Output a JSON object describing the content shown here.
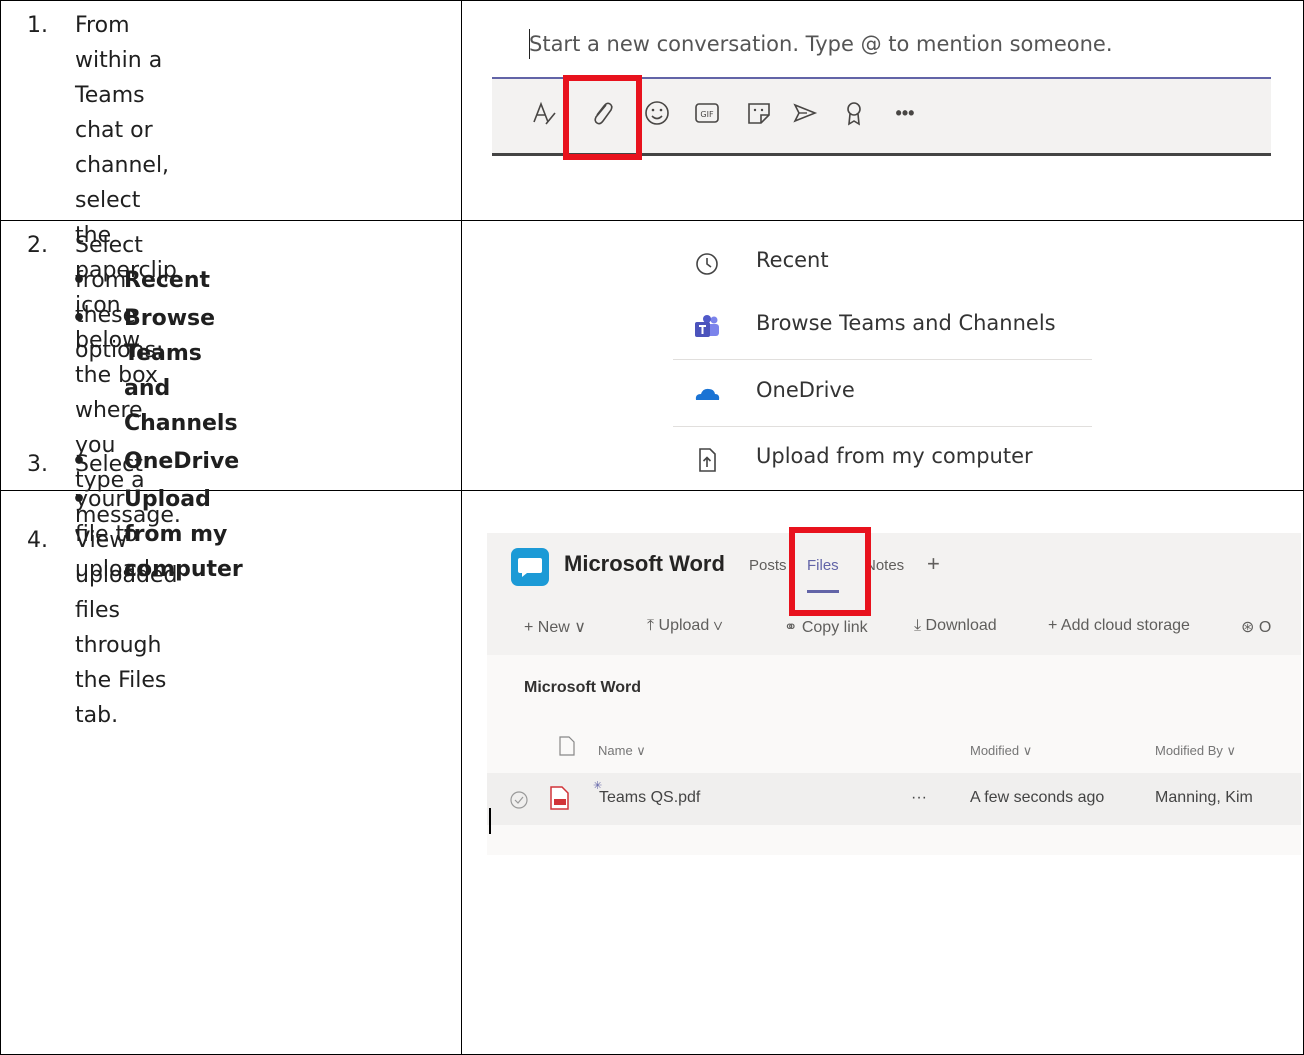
{
  "steps": [
    {
      "num": "1.",
      "lines": [
        "From within a Teams chat or",
        "channel, select the paperclip",
        "icon below the box where you",
        "type a message."
      ]
    },
    {
      "num": "2.",
      "text": "Select from these options:",
      "bullets": [
        "Recent",
        "Browse Teams and",
        "Channels",
        "OneDrive",
        "Upload from my computer"
      ]
    },
    {
      "num": "3.",
      "text": "Select your file to upload."
    },
    {
      "num": "4.",
      "lines": [
        "View uploaded files through",
        "the Files tab."
      ]
    }
  ],
  "compose": {
    "placeholder": "Start a new conversation. Type @ to mention someone.",
    "toolbar_icons": [
      "format-icon",
      "paperclip-icon",
      "emoji-icon",
      "gif-icon",
      "sticker-icon",
      "send-later-icon",
      "praise-icon",
      "more-icon"
    ],
    "gif_label": "GIF",
    "more_label": "•••"
  },
  "attach_menu": [
    {
      "icon": "clock-icon",
      "label": "Recent"
    },
    {
      "icon": "teams-icon",
      "label": "Browse Teams and Channels"
    },
    {
      "icon": "onedrive-icon",
      "label": "OneDrive"
    },
    {
      "icon": "upload-icon",
      "label": "Upload from my computer"
    }
  ],
  "files_view": {
    "app_title": "Microsoft Word",
    "tabs": [
      "Posts",
      "Files",
      "Notes"
    ],
    "add_tab": "+",
    "commands": {
      "new": "+ New ∨",
      "upload": "⤒ Upload ∨",
      "copy_link": "⚭ Copy link",
      "download": "⤓ Download",
      "add_storage": "+ Add cloud storage",
      "open": "⊛ O"
    },
    "breadcrumb": "Microsoft Word",
    "columns": {
      "name": "Name ∨",
      "modified": "Modified ∨",
      "modified_by": "Modified By ∨"
    },
    "row": {
      "name": "Teams QS.pdf",
      "more": "···",
      "modified": "A few seconds ago",
      "modified_by": "Manning, Kim"
    }
  },
  "colors": {
    "accent": "#6264a7",
    "highlight": "#e8121d",
    "teams_icon_bg": "#1c9ad6"
  }
}
